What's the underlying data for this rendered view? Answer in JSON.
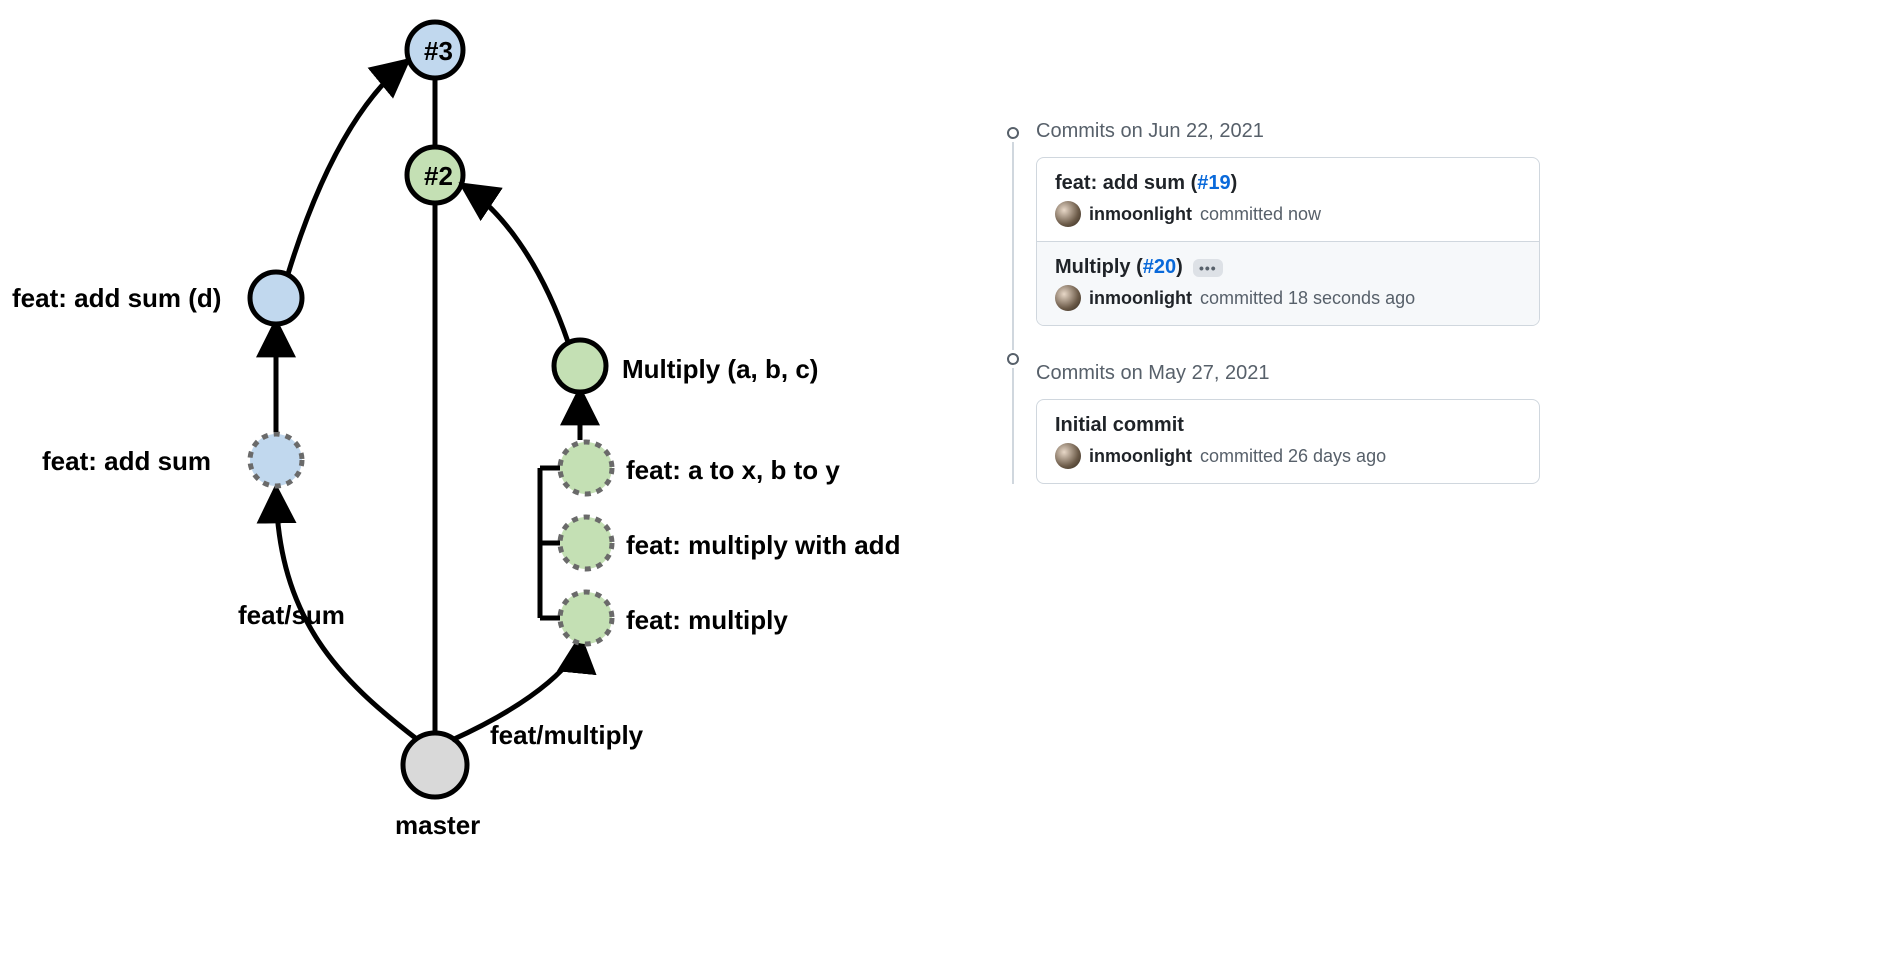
{
  "diagram": {
    "nodes": {
      "n3": "#3",
      "n2": "#2",
      "master_label": "master",
      "branch_sum": "feat/sum",
      "branch_multiply": "feat/multiply",
      "sum_d": "feat: add sum (d)",
      "sum": "feat: add sum",
      "multiply_abc": "Multiply (a, b, c)",
      "mult_atoxtoy": "feat: a to x, b to y",
      "mult_withadd": "feat: multiply with add",
      "mult_base": "feat: multiply"
    }
  },
  "commits": {
    "groups": [
      {
        "date_label": "Commits on Jun 22, 2021",
        "rows": [
          {
            "title_prefix": "feat: add sum (",
            "pr": "#19",
            "title_suffix": ")",
            "author": "inmoonlight",
            "meta_rest": "committed now",
            "highlight": false,
            "show_ellipsis": false
          },
          {
            "title_prefix": "Multiply (",
            "pr": "#20",
            "title_suffix": ")",
            "author": "inmoonlight",
            "meta_rest": "committed 18 seconds ago",
            "highlight": true,
            "show_ellipsis": true
          }
        ]
      },
      {
        "date_label": "Commits on May 27, 2021",
        "rows": [
          {
            "title_prefix": "Initial commit",
            "pr": "",
            "title_suffix": "",
            "author": "inmoonlight",
            "meta_rest": "committed 26 days ago",
            "highlight": false,
            "show_ellipsis": false
          }
        ]
      }
    ]
  },
  "colors": {
    "blue_fill": "#c1d8ee",
    "green_fill": "#c4e0b4",
    "grey_fill": "#d9d9d9",
    "stroke": "#000000",
    "link_blue": "#0969da"
  }
}
